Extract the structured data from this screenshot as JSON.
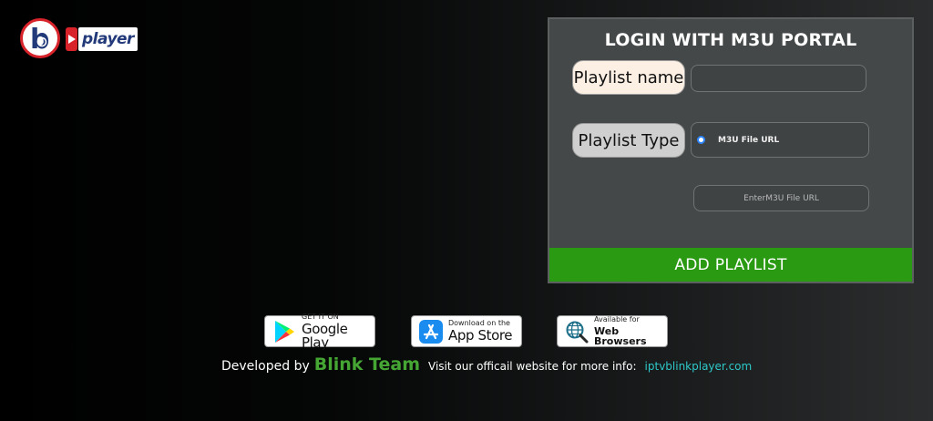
{
  "logo": {
    "letter": "b",
    "text": "player",
    "colors": {
      "red": "#d8232a",
      "blue": "#233a7a"
    }
  },
  "login": {
    "title": "LOGIN WITH M3U PORTAL",
    "playlist_name_label": "Playlist name",
    "playlist_name_value": "",
    "playlist_type_label": "Playlist Type",
    "playlist_type_option": "M3U File URL",
    "url_placeholder": "EnterM3U File URL",
    "add_button_label": "ADD PLAYLIST",
    "colors": {
      "button": "#2b9a13",
      "panel": "#444849"
    }
  },
  "badges": {
    "google": {
      "small": "GET IT ON",
      "big": "Google Play",
      "icon": "google-play-icon"
    },
    "apple": {
      "small": "Download on the",
      "big": "App Store",
      "icon": "app-store-icon"
    },
    "web": {
      "small": "Available for",
      "big": "Web Browsers",
      "icon": "globe-search-icon"
    }
  },
  "footer": {
    "developed_by": "Developed by",
    "team": "Blink Team",
    "visit_text": "Visit our officail website for more info:",
    "website": "iptvblinkplayer.com",
    "colors": {
      "team": "#45a634",
      "link": "#2ec8c8"
    }
  }
}
